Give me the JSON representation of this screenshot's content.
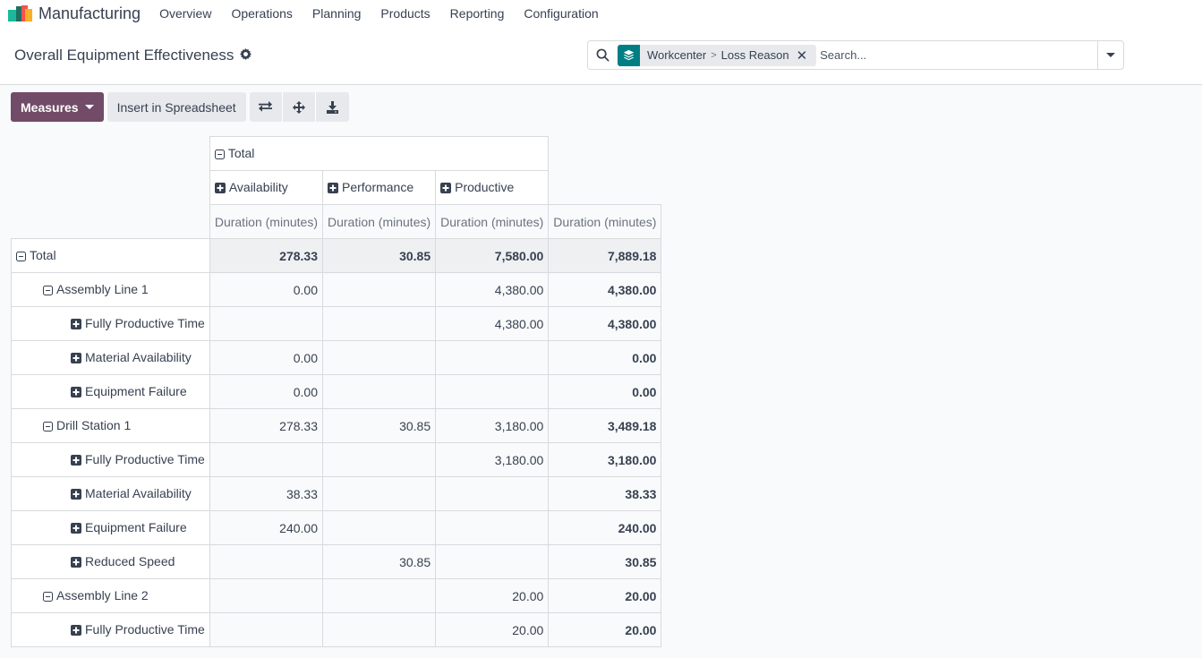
{
  "navbar": {
    "app_name": "Manufacturing",
    "menu": [
      "Overview",
      "Operations",
      "Planning",
      "Products",
      "Reporting",
      "Configuration"
    ]
  },
  "control_panel": {
    "title": "Overall Equipment Effectiveness",
    "search": {
      "facet_icon": "layers-icon",
      "facet_values": [
        "Workcenter",
        "Loss Reason"
      ],
      "facet_separator": ">",
      "placeholder": "Search..."
    }
  },
  "toolbar": {
    "measures_label": "Measures",
    "insert_label": "Insert in Spreadsheet",
    "icons": [
      "flip-axis-icon",
      "expand-all-icon",
      "download-icon"
    ]
  },
  "colors": {
    "primary": "#714b67",
    "facet": "#017e84"
  },
  "pivot": {
    "column_total_label": "Total",
    "column_groups": [
      "Availability",
      "Performance",
      "Productive"
    ],
    "measure_label": "Duration (minutes)",
    "rows": [
      {
        "label": "Total",
        "level": 0,
        "expanded": true,
        "values": [
          "278.33",
          "30.85",
          "7,580.00",
          "7,889.18"
        ]
      },
      {
        "label": "Assembly Line 1",
        "level": 1,
        "expanded": true,
        "values": [
          "0.00",
          "",
          "4,380.00",
          "4,380.00"
        ]
      },
      {
        "label": "Fully Productive Time",
        "level": 2,
        "expanded": false,
        "values": [
          "",
          "",
          "4,380.00",
          "4,380.00"
        ]
      },
      {
        "label": "Material Availability",
        "level": 2,
        "expanded": false,
        "values": [
          "0.00",
          "",
          "",
          "0.00"
        ]
      },
      {
        "label": "Equipment Failure",
        "level": 2,
        "expanded": false,
        "values": [
          "0.00",
          "",
          "",
          "0.00"
        ]
      },
      {
        "label": "Drill Station 1",
        "level": 1,
        "expanded": true,
        "values": [
          "278.33",
          "30.85",
          "3,180.00",
          "3,489.18"
        ]
      },
      {
        "label": "Fully Productive Time",
        "level": 2,
        "expanded": false,
        "values": [
          "",
          "",
          "3,180.00",
          "3,180.00"
        ]
      },
      {
        "label": "Material Availability",
        "level": 2,
        "expanded": false,
        "values": [
          "38.33",
          "",
          "",
          "38.33"
        ]
      },
      {
        "label": "Equipment Failure",
        "level": 2,
        "expanded": false,
        "values": [
          "240.00",
          "",
          "",
          "240.00"
        ]
      },
      {
        "label": "Reduced Speed",
        "level": 2,
        "expanded": false,
        "values": [
          "",
          "30.85",
          "",
          "30.85"
        ]
      },
      {
        "label": "Assembly Line 2",
        "level": 1,
        "expanded": true,
        "values": [
          "",
          "",
          "20.00",
          "20.00"
        ]
      },
      {
        "label": "Fully Productive Time",
        "level": 2,
        "expanded": false,
        "values": [
          "",
          "",
          "20.00",
          "20.00"
        ]
      }
    ]
  }
}
